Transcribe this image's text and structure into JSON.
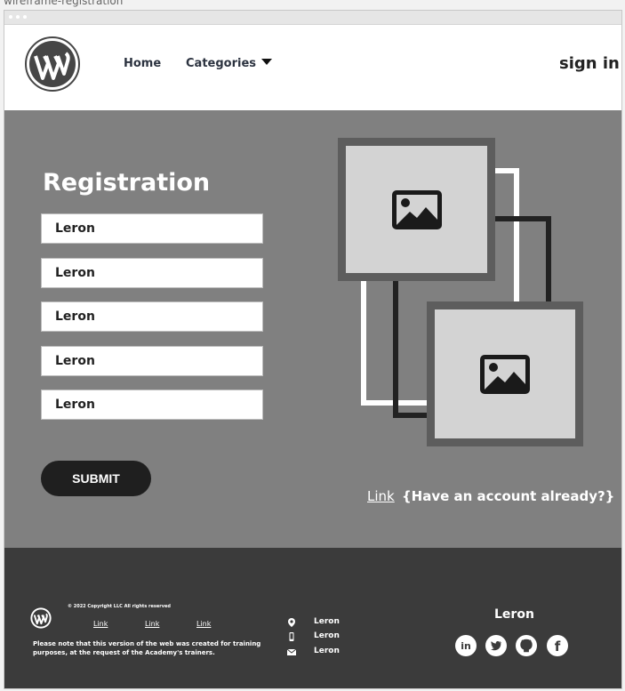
{
  "page_label": "wireframe-registration",
  "header": {
    "nav": {
      "home": "Home",
      "categories": "Categories"
    },
    "sign_in": "sign in"
  },
  "registration": {
    "title": "Registration",
    "fields": [
      "Leron",
      "Leron",
      "Leron",
      "Leron",
      "Leron"
    ],
    "submit": "SUBMIT",
    "link": "Link",
    "account_prompt": "{Have an account already?}"
  },
  "footer": {
    "copyright": "© 2022 Copyright LLC All rights reserved",
    "links": [
      "Link",
      "Link",
      "Link"
    ],
    "note": "Please note that this version of the web was created for training purposes, at the request of the Academy's trainers.",
    "contacts": [
      {
        "icon": "location-pin-icon",
        "text": "Leron"
      },
      {
        "icon": "mobile-phone-icon",
        "text": "Leron"
      },
      {
        "icon": "envelope-icon",
        "text": "Leron"
      }
    ],
    "brand": "Leron",
    "social": [
      "linkedin-icon",
      "twitter-icon",
      "github-icon",
      "facebook-icon"
    ]
  },
  "colors": {
    "main_bg": "#808080",
    "footer_bg": "#3b3b3b",
    "button_bg": "#1f1f1f",
    "image_frame": "#5d5d5d"
  }
}
